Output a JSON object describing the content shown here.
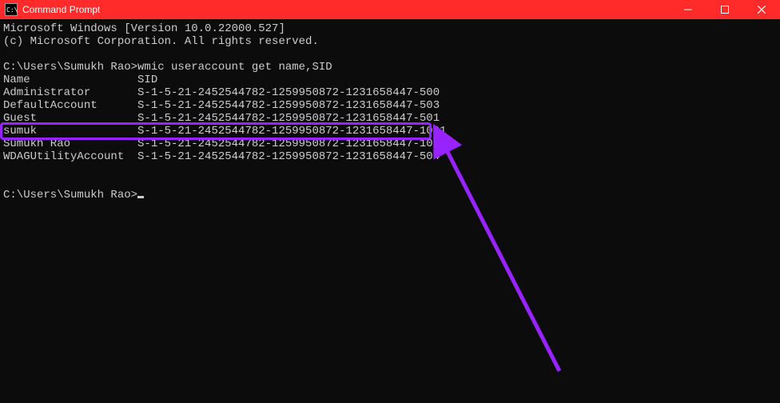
{
  "window": {
    "title": "Command Prompt"
  },
  "lines": {
    "ver": "Microsoft Windows [Version 10.0.22000.527]",
    "copy": "(c) Microsoft Corporation. All rights reserved.",
    "blank": "",
    "prompt1": "C:\\Users\\Sumukh Rao>wmic useraccount get name,SID",
    "hdr": "Name                SID",
    "r0": "Administrator       S-1-5-21-2452544782-1259950872-1231658447-500",
    "r1": "DefaultAccount      S-1-5-21-2452544782-1259950872-1231658447-503",
    "r2": "Guest               S-1-5-21-2452544782-1259950872-1231658447-501",
    "r3": "sumuk               S-1-5-21-2452544782-1259950872-1231658447-1001",
    "r4": "Sumukh Rao          S-1-5-21-2452544782-1259950872-1231658447-1004",
    "r5": "WDAGUtilityAccount  S-1-5-21-2452544782-1259950872-1231658447-504",
    "blank2": "",
    "blank3": "",
    "prompt2": "C:\\Users\\Sumukh Rao>"
  },
  "annotation": {
    "highlight_row_index": 3,
    "highlight_color": "#9823ff"
  }
}
